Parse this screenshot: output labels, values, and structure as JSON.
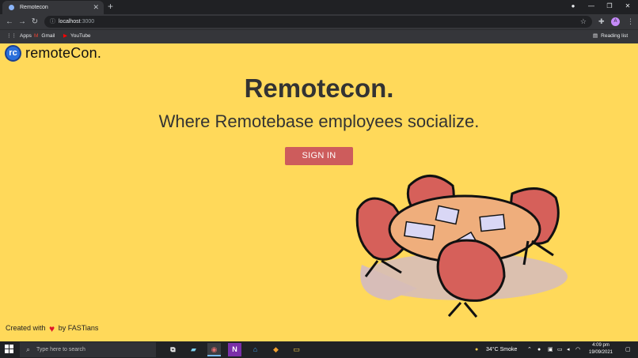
{
  "browser": {
    "tab_title": "Remotecon",
    "tab_close": "✕",
    "new_tab": "+",
    "url_host": "localhost",
    "url_port": ":3000",
    "bookmarks": [
      "Apps",
      "Gmail",
      "YouTube"
    ],
    "reading_list": "Reading list",
    "profile_initial": "A"
  },
  "page": {
    "logo_text": "remoteCon.",
    "title": "Remotecon.",
    "subtitle": "Where Remotebase employees socialize.",
    "signin_label": "SIGN IN",
    "footer_prefix": "Created with",
    "footer_suffix": "by FASTians"
  },
  "taskbar": {
    "search_placeholder": "Type here to search",
    "weather": "34°C  Smoke",
    "time": "4:09 pm",
    "date": "19/09/2021"
  },
  "colors": {
    "page_background": "#ffd95a",
    "signin_button": "#cd5c5c",
    "text": "#333333"
  }
}
